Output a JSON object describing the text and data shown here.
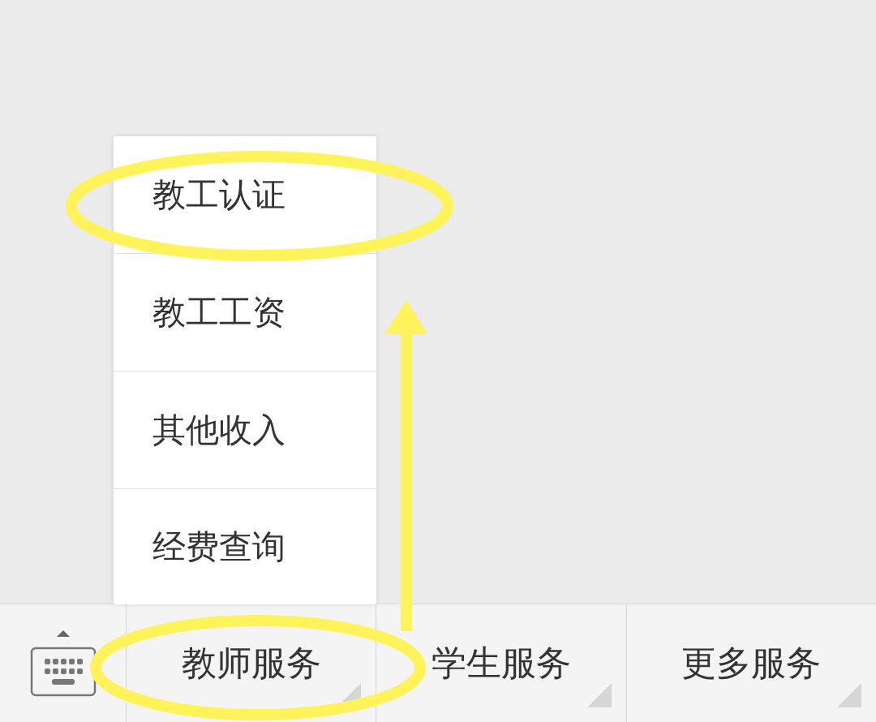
{
  "popup_menu": {
    "items": [
      {
        "label": "教工认证"
      },
      {
        "label": "教工工资"
      },
      {
        "label": "其他收入"
      },
      {
        "label": "经费查询"
      }
    ]
  },
  "bottom_menu": {
    "tabs": [
      {
        "label": "教师服务"
      },
      {
        "label": "学生服务"
      },
      {
        "label": "更多服务"
      }
    ]
  }
}
